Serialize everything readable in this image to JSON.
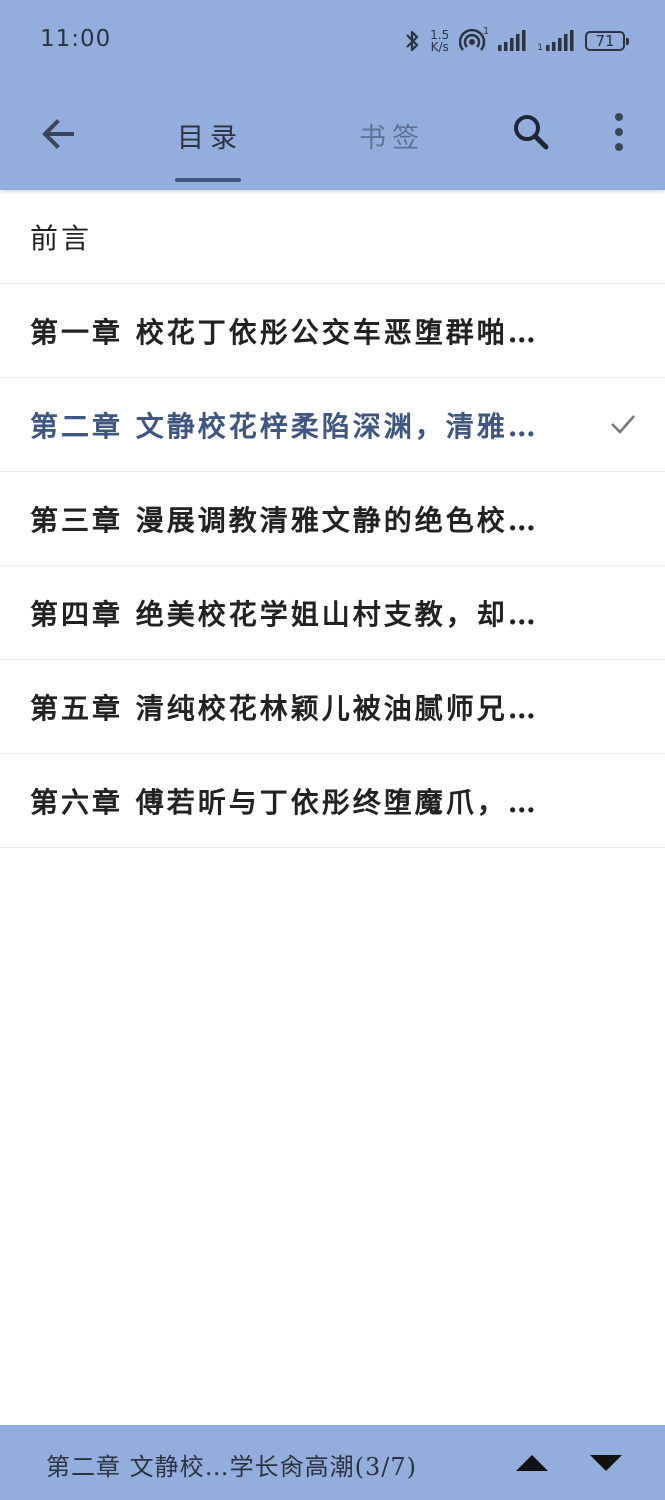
{
  "status_bar": {
    "time": "11:00",
    "speed_value": "1.5",
    "speed_unit": "K/s",
    "hotspot_badge": "1",
    "signal_badge": "1",
    "battery": "71"
  },
  "toolbar": {
    "tabs": [
      {
        "label": "目录",
        "active": true
      },
      {
        "label": "书签",
        "active": false
      }
    ]
  },
  "chapters": [
    {
      "title": "前言"
    },
    {
      "title": "第一章  校花丁依彤公交车恶堕群啪…"
    },
    {
      "title": "第二章  文静校花梓柔陷深渊，清雅…",
      "current": true
    },
    {
      "title": "第三章  漫展调教清雅文静的绝色校…"
    },
    {
      "title": "第四章  绝美校花学姐山村支教，却…"
    },
    {
      "title": "第五章  清纯校花林颖儿被油腻师兄…"
    },
    {
      "title": "第六章  傅若昕与丁依彤终堕魔爪，…"
    }
  ],
  "footer": {
    "current_chapter": "第二章  文静校…学长肏高潮(3/7)"
  },
  "colors": {
    "header_bg": "#93AEDD",
    "accent": "#3f5680"
  }
}
